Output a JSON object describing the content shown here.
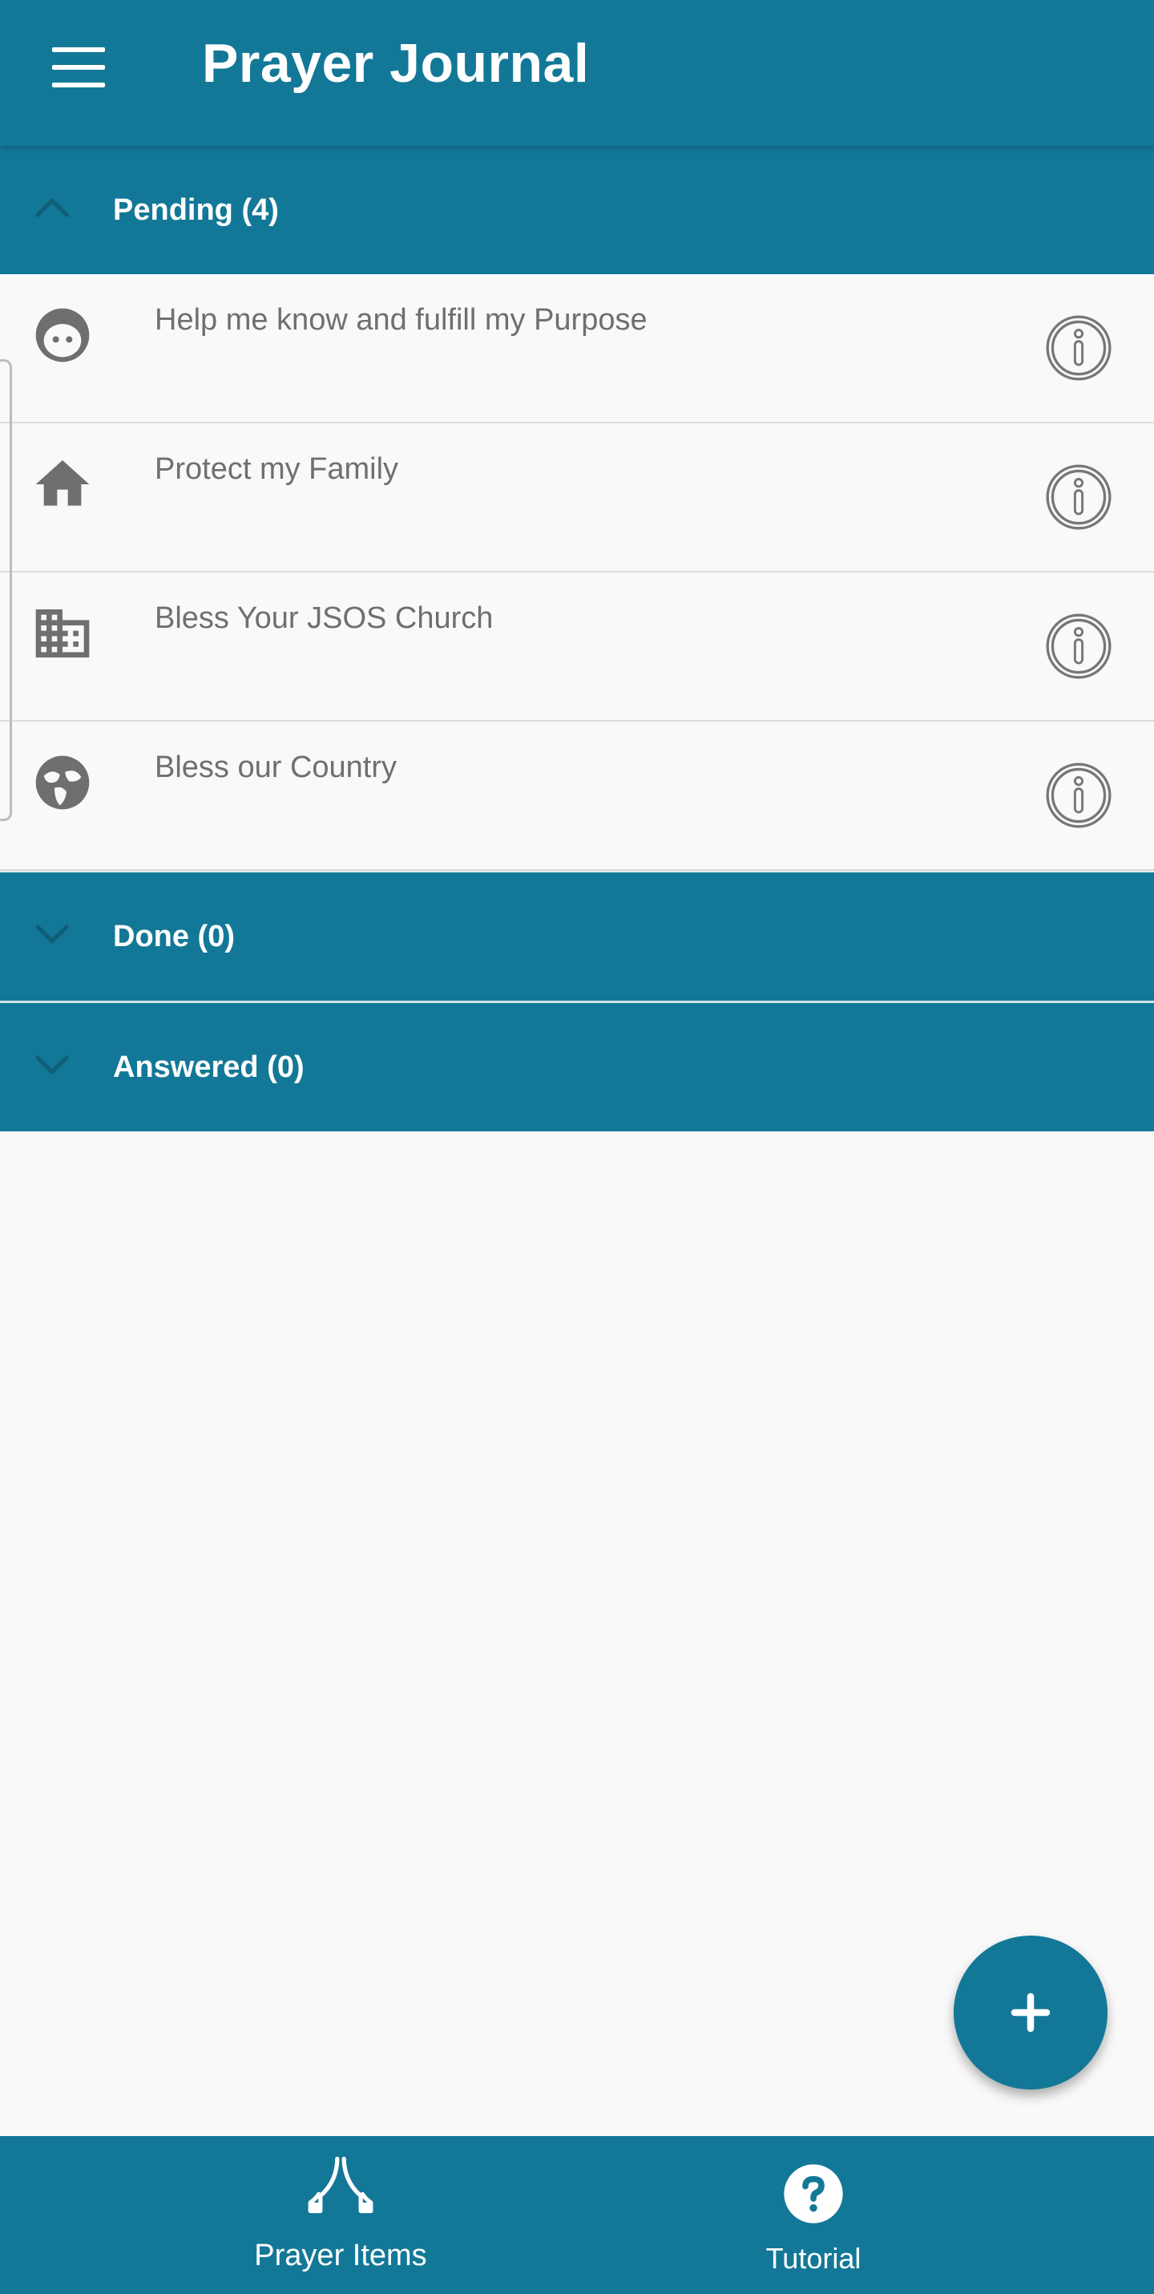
{
  "app": {
    "title": "Prayer Journal"
  },
  "sections": {
    "pending": {
      "label": "Pending (4)"
    },
    "done": {
      "label": "Done (0)"
    },
    "answered": {
      "label": "Answered (0)"
    }
  },
  "pending_items": [
    {
      "text": "Help me know and fulfill my Purpose",
      "icon": "face-icon"
    },
    {
      "text": "Protect my Family",
      "icon": "home-icon"
    },
    {
      "text": "Bless Your JSOS Church",
      "icon": "building-icon"
    },
    {
      "text": "Bless our Country",
      "icon": "globe-icon"
    }
  ],
  "fab": {
    "icon": "plus-icon"
  },
  "bottom_nav": {
    "items": [
      {
        "label": "Prayer Items",
        "icon": "praying-hands-icon"
      },
      {
        "label": "Tutorial",
        "icon": "help-circle-icon"
      }
    ]
  },
  "colors": {
    "primary": "#137897",
    "background": "#f9f9f9",
    "item_text": "#6f6f6f",
    "icon_gray": "#6f6f6f"
  }
}
